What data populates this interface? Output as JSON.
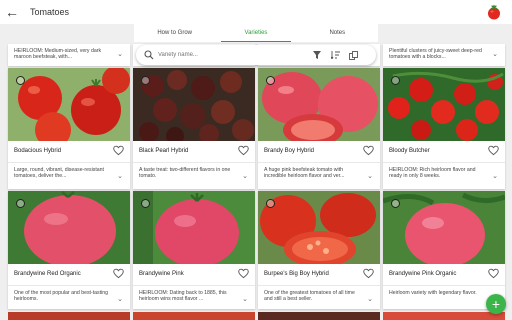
{
  "appbar": {
    "title": "Tomatoes",
    "back_icon": "arrow-back-icon",
    "logo_icon": "tomato-icon"
  },
  "tabs": [
    {
      "label": "How to Grow",
      "active": false
    },
    {
      "label": "Varieties",
      "active": true
    },
    {
      "label": "Notes",
      "active": false
    }
  ],
  "search": {
    "placeholder": "Variety name...",
    "value": ""
  },
  "toolbar_icons": [
    "filter-icon",
    "sort-icon",
    "compare-icon"
  ],
  "top_partial": [
    {
      "desc": "HEIRLOOM: Medium-sized, very dark maroon beefsteak, with..."
    },
    {
      "desc": ""
    },
    {
      "desc": ""
    },
    {
      "desc": "Plentiful clusters of juicy-sweet deep-red tomatoes with a blocks..."
    }
  ],
  "varieties": [
    {
      "name": "Bodacious Hybrid",
      "desc": "Large, round, vibrant, disease-resistant tomatoes, deliver the...",
      "photo": "red-round"
    },
    {
      "name": "Black Pearl Hybrid",
      "desc": "A taste treat: two-different flavors in one tomato.",
      "photo": "black-cherry"
    },
    {
      "name": "Brandy Boy  Hybrid",
      "desc": "A huge pink beefsteak tomato with incredible heirloom flavor and ver...",
      "photo": "pink-sliced"
    },
    {
      "name": "Bloody Butcher",
      "desc": "HEIRLOOM: Rich heirloom flavor and ready in only 8 weeks.",
      "photo": "red-cluster"
    },
    {
      "name": "Brandywine Red Organic",
      "desc": "One of the most popular and best-tasting heirlooms.",
      "photo": "pink-single"
    },
    {
      "name": "Brandywine Pink",
      "desc": "HEIRLOOM: Dating back to 1885, this heirloom wins most flavor ...",
      "photo": "pink-single"
    },
    {
      "name": "Burpee's Big Boy  Hybrid",
      "desc": "One of the greatest tomatoes of all time and still a best seller.",
      "photo": "red-sliced"
    },
    {
      "name": "Brandywine Pink Organic",
      "desc": "Heirloom variety with legendary flavor.",
      "photo": "pink-leaves"
    }
  ],
  "fab": {
    "label": "+"
  }
}
